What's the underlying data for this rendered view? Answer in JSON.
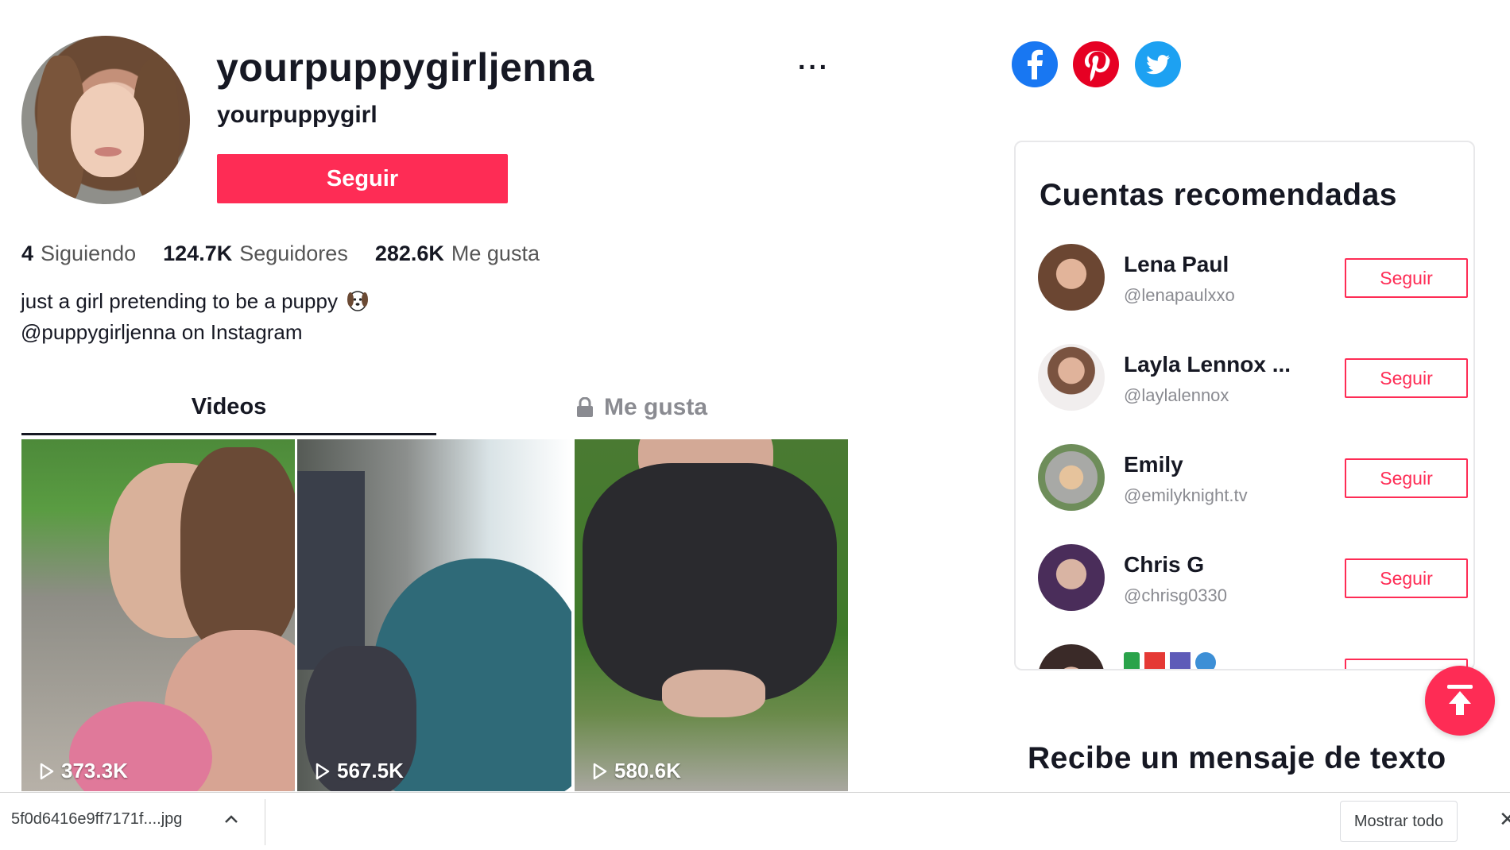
{
  "profile": {
    "username": "yourpuppygirljenna",
    "nickname": "yourpuppygirl",
    "follow_label": "Seguir",
    "more_label": "···",
    "stats": [
      {
        "value": "4",
        "label": "Siguiendo"
      },
      {
        "value": "124.7K",
        "label": "Seguidores"
      },
      {
        "value": "282.6K",
        "label": "Me gusta"
      }
    ],
    "bio_line1": "just a girl pretending to be a puppy",
    "bio_line2": "@puppygirljenna on Instagram"
  },
  "tabs": {
    "videos": "Videos",
    "likes": "Me gusta"
  },
  "videos": [
    {
      "views": "373.3K"
    },
    {
      "views": "567.5K"
    },
    {
      "views": "580.6K"
    }
  ],
  "social": [
    "facebook-icon",
    "pinterest-icon",
    "twitter-icon"
  ],
  "recommended": {
    "title": "Cuentas recomendadas",
    "accounts": [
      {
        "name": "Lena Paul",
        "handle": "@lenapaulxxo",
        "follow": "Seguir"
      },
      {
        "name": "Layla Lennox ...",
        "handle": "@laylalennox",
        "follow": "Seguir"
      },
      {
        "name": "Emily",
        "handle": "@emilyknight.tv",
        "follow": "Seguir"
      },
      {
        "name": "Chris G",
        "handle": "@chrisg0330",
        "follow": "Seguir"
      }
    ]
  },
  "sms_heading": "Recibe un mensaje de texto",
  "download_bar": {
    "file_name": "5f0d6416e9ff7171f....jpg",
    "show_all": "Mostrar todo",
    "close": "✕"
  },
  "colors": {
    "accent": "#fe2c55",
    "text": "#161823",
    "muted": "#8a8b91"
  }
}
